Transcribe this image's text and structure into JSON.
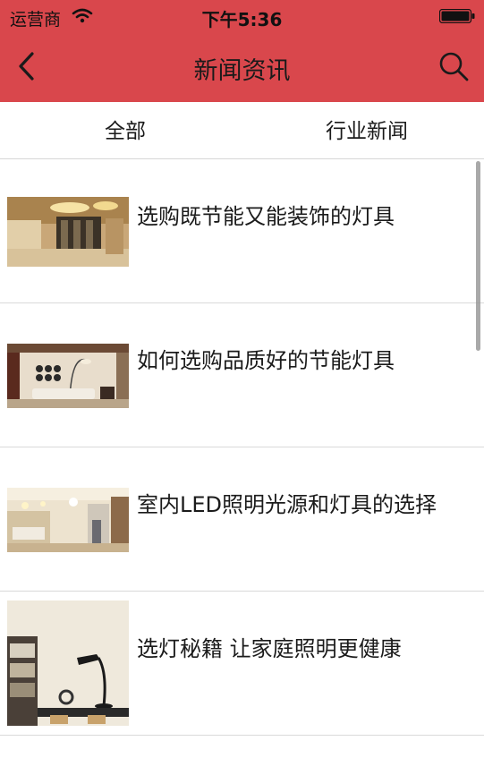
{
  "status_bar": {
    "carrier": "运营商",
    "time": "下午5:36"
  },
  "nav": {
    "title": "新闻资讯"
  },
  "tabs": [
    {
      "label": "全部"
    },
    {
      "label": "行业新闻"
    }
  ],
  "news": [
    {
      "title": "选购既节能又能装饰的灯具",
      "image": "hotel-lobby-lighting"
    },
    {
      "title": "如何选购品质好的节能灯具",
      "image": "living-room-lamp"
    },
    {
      "title": "室内LED照明光源和灯具的选择",
      "image": "interior-led-room"
    },
    {
      "title": "选灯秘籍 让家庭照明更健康",
      "image": "desk-lamp-shelf"
    }
  ],
  "colors": {
    "header": "#d9474c",
    "divider": "#d9d9d9"
  }
}
